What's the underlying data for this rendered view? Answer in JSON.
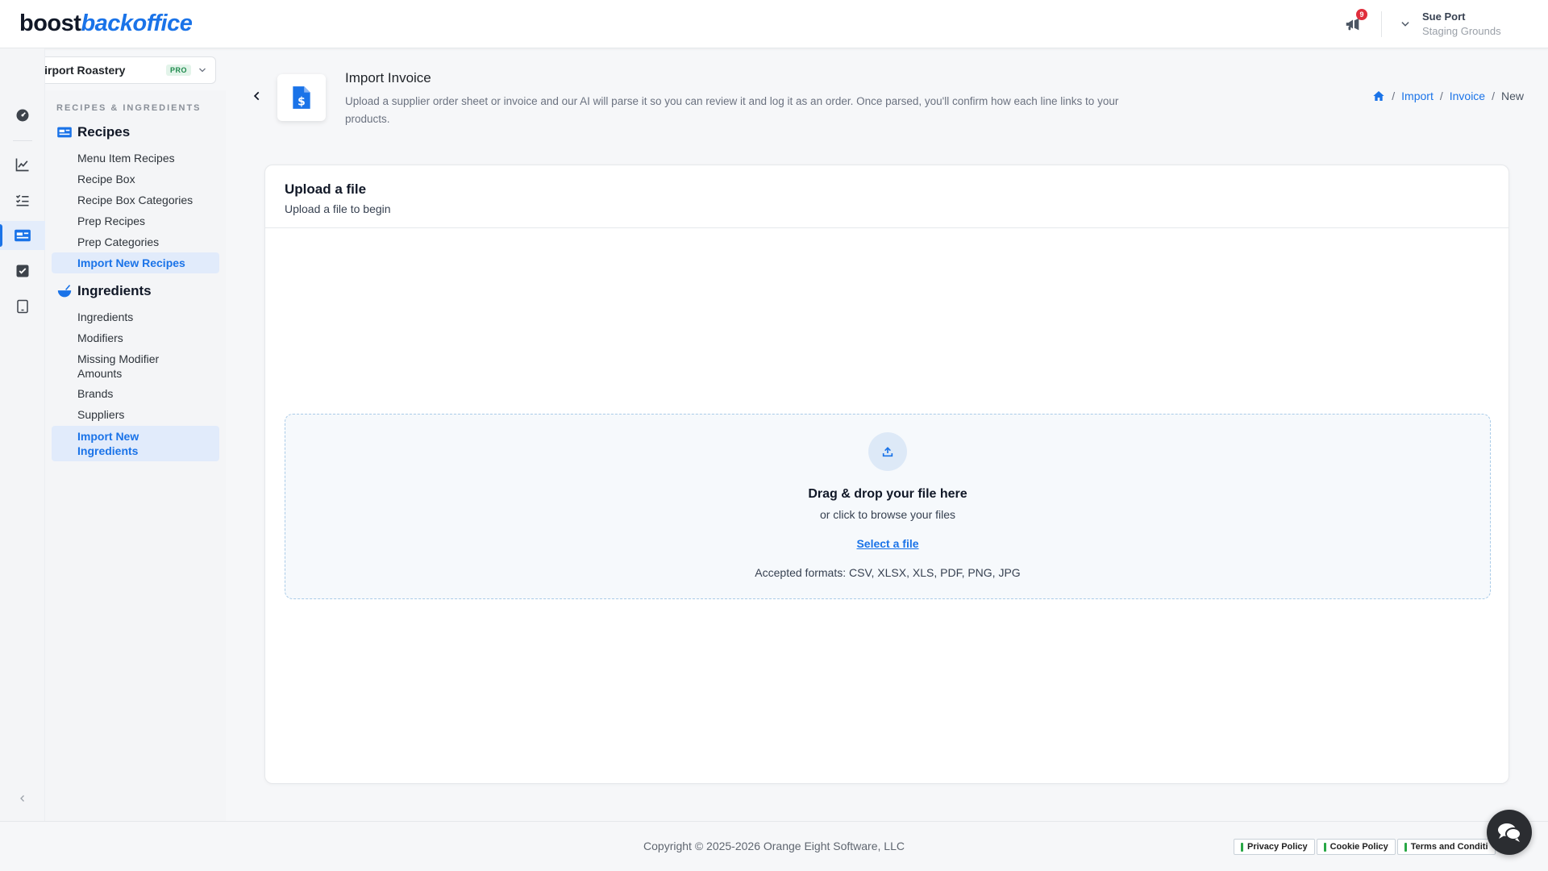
{
  "header": {
    "logo_dark": "boost",
    "logo_blue": "backoffice",
    "notification_count": "9",
    "user_name": "Sue Port",
    "user_location": "Staging Grounds"
  },
  "location": {
    "name": "Airport Roastery",
    "plan": "PRO"
  },
  "rail": {
    "items": [
      {
        "icon": "dashboard-icon"
      },
      {
        "icon": "chart-line-icon"
      },
      {
        "icon": "checklist-icon"
      },
      {
        "icon": "recipes-card-icon",
        "active": true
      },
      {
        "icon": "checkbox-icon"
      },
      {
        "icon": "tablet-icon"
      }
    ]
  },
  "sidebar": {
    "heading": "RECIPES & INGREDIENTS",
    "recipes_title": "Recipes",
    "recipes_items": [
      "Menu Item Recipes",
      "Recipe Box",
      "Recipe Box Categories",
      "Prep Recipes",
      "Prep Categories",
      "Import New Recipes"
    ],
    "ingredients_title": "Ingredients",
    "ingredients_items": [
      "Ingredients",
      "Modifiers",
      "Missing Modifier Amounts",
      "Brands",
      "Suppliers",
      "Import New Ingredients"
    ]
  },
  "page": {
    "title": "Import Invoice",
    "description": "Upload a supplier order sheet or invoice and our AI will parse it so you can review it and log it as an order. Once parsed, you'll confirm how each line links to your products."
  },
  "breadcrumb": {
    "import": "Import",
    "invoice": "Invoice",
    "current": "New"
  },
  "card": {
    "title": "Upload a file",
    "subtitle": "Upload a file to begin"
  },
  "dropzone": {
    "title": "Drag & drop your file here",
    "subtitle": "or click to browse your files",
    "select_label": "Select a file",
    "formats": "Accepted formats: CSV, XLSX, XLS, PDF, PNG, JPG"
  },
  "footer": {
    "copyright": "Copyright © 2025-2026 Orange Eight Software, LLC",
    "privacy": "Privacy Policy",
    "cookie": "Cookie Policy",
    "terms": "Terms and Conditi"
  },
  "colors": {
    "accent": "#1a73e8",
    "badge": "#e02e3c",
    "pro_badge": "#1e8a4c"
  }
}
